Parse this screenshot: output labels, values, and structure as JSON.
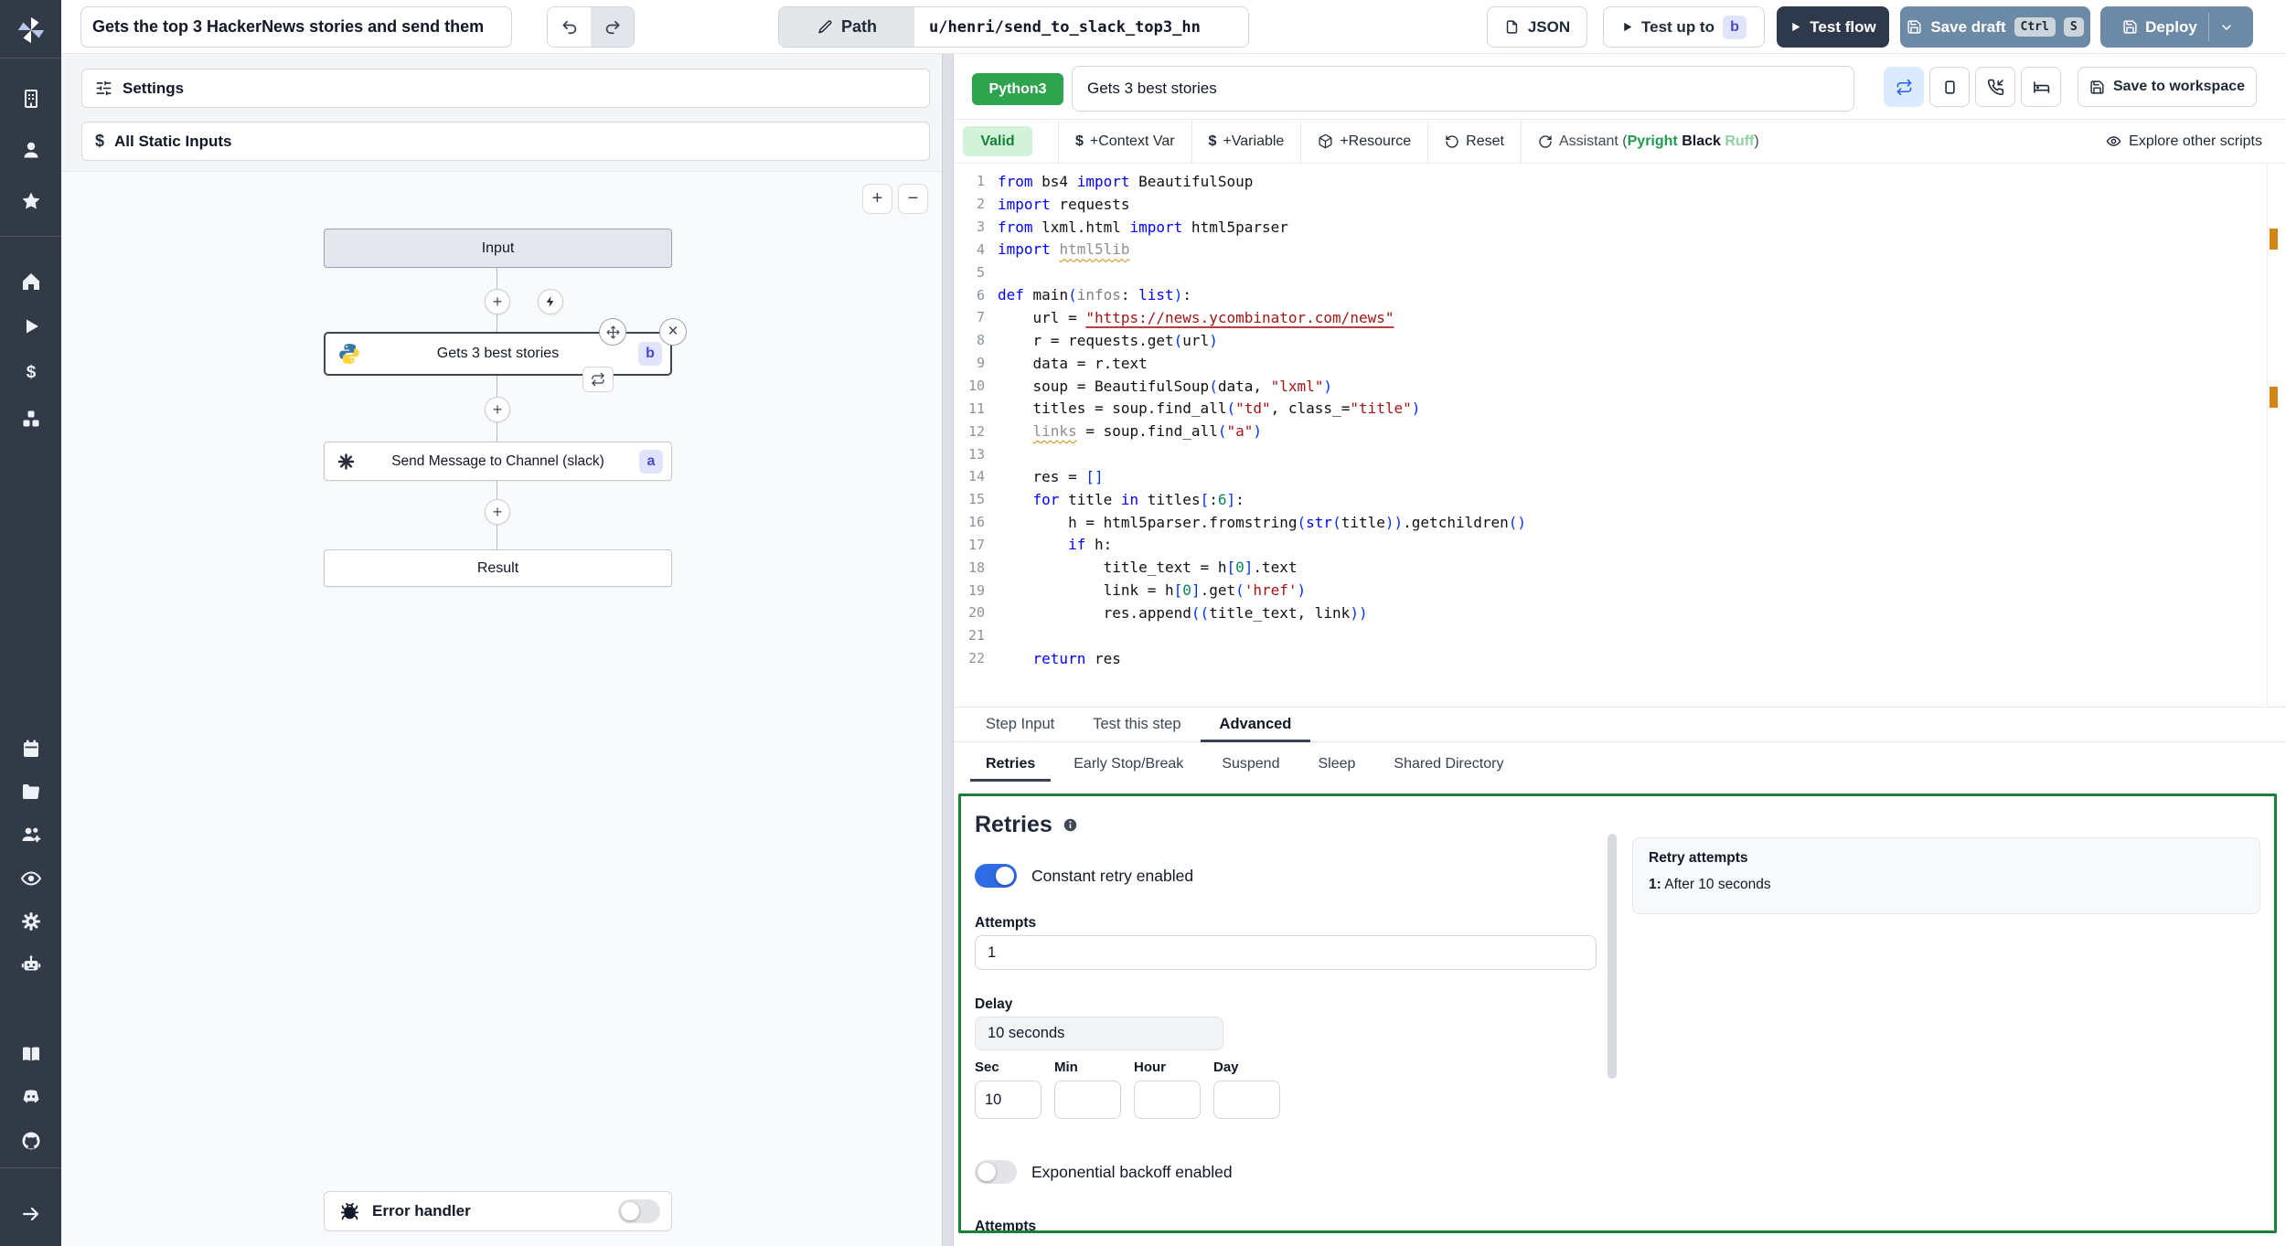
{
  "topbar": {
    "flow_title": "Gets the top 3 HackerNews stories and send them",
    "path_label": "Path",
    "path_value": "u/henri/send_to_slack_top3_hn",
    "json_button": "JSON",
    "test_up_to": "Test up to",
    "step_badge_b": "b",
    "test_flow": "Test flow",
    "save_draft": "Save draft",
    "kbd": [
      "Ctrl",
      "S"
    ],
    "deploy": "Deploy"
  },
  "sidebar": {
    "icons": [
      "windmill-logo",
      "building",
      "user",
      "star",
      "home",
      "play",
      "dollar",
      "boxes",
      "calendar",
      "folder",
      "user-group",
      "eye",
      "gear",
      "robot",
      "book",
      "discord",
      "github",
      "arrow-right"
    ]
  },
  "flow": {
    "settings_label": "Settings",
    "static_inputs_label": "All Static Inputs",
    "input_node": "Input",
    "step_b_label": "Gets 3 best stories",
    "step_b_badge": "b",
    "step_a_label": "Send Message to Channel (slack)",
    "step_a_badge": "a",
    "result_node": "Result",
    "error_handler_label": "Error handler"
  },
  "canvas": {
    "zoom_in": "+",
    "zoom_out": "−"
  },
  "editor": {
    "language": "Python3",
    "name": "Gets 3 best stories",
    "save_to_workspace": "Save to workspace",
    "toolbar": {
      "valid": "Valid",
      "context_var": "+Context Var",
      "variable": "+Variable",
      "resource": "+Resource",
      "reset": "Reset",
      "assistant_parts": [
        {
          "c": "d",
          "t": "Assistant "
        },
        {
          "c": "d",
          "t": "("
        },
        {
          "c": "g",
          "t": "Pyright"
        },
        {
          "c": "d",
          "t": " "
        },
        {
          "c": "b",
          "t": "Black"
        },
        {
          "c": "d",
          "t": " "
        },
        {
          "c": "l",
          "t": "Ruff"
        },
        {
          "c": "d",
          "t": ")"
        }
      ],
      "explore": "Explore other scripts"
    },
    "code_lines": [
      [
        [
          "k",
          "from"
        ],
        [
          "d",
          " bs4 "
        ],
        [
          "k",
          "import"
        ],
        [
          "d",
          " BeautifulSoup"
        ]
      ],
      [
        [
          "k",
          "import"
        ],
        [
          "d",
          " requests"
        ]
      ],
      [
        [
          "k",
          "from"
        ],
        [
          "d",
          " lxml.html "
        ],
        [
          "k",
          "import"
        ],
        [
          "d",
          " html5parser"
        ]
      ],
      [
        [
          "k",
          "import"
        ],
        [
          "d",
          " "
        ],
        [
          "u",
          "html5lib"
        ]
      ],
      [],
      [
        [
          "k",
          "def"
        ],
        [
          "d",
          " main"
        ],
        [
          "p",
          "("
        ],
        [
          "g",
          "infos"
        ],
        [
          "d",
          ": "
        ],
        [
          "k",
          "list"
        ],
        [
          "p",
          ")"
        ],
        [
          "d",
          ":"
        ]
      ],
      [
        [
          "d",
          "    url = "
        ],
        [
          "sl",
          "\"https://news.ycombinator.com/news\""
        ]
      ],
      [
        [
          "d",
          "    r = requests.get"
        ],
        [
          "p",
          "("
        ],
        [
          "d",
          "url"
        ],
        [
          "p",
          ")"
        ]
      ],
      [
        [
          "d",
          "    data = r.text"
        ]
      ],
      [
        [
          "d",
          "    soup = BeautifulSoup"
        ],
        [
          "p",
          "("
        ],
        [
          "d",
          "data, "
        ],
        [
          "s",
          "\"lxml\""
        ],
        [
          "p",
          ")"
        ]
      ],
      [
        [
          "d",
          "    titles = soup.find_all"
        ],
        [
          "p",
          "("
        ],
        [
          "s",
          "\"td\""
        ],
        [
          "d",
          ", class_="
        ],
        [
          "s",
          "\"title\""
        ],
        [
          "p",
          ")"
        ]
      ],
      [
        [
          "d",
          "    "
        ],
        [
          "u",
          "links"
        ],
        [
          "d",
          " = soup.find_all"
        ],
        [
          "p",
          "("
        ],
        [
          "s",
          "\"a\""
        ],
        [
          "p",
          ")"
        ]
      ],
      [],
      [
        [
          "d",
          "    res = "
        ],
        [
          "p",
          "[]"
        ]
      ],
      [
        [
          "d",
          "    "
        ],
        [
          "k",
          "for"
        ],
        [
          "d",
          " title "
        ],
        [
          "k",
          "in"
        ],
        [
          "d",
          " titles"
        ],
        [
          "p",
          "["
        ],
        [
          "d",
          ":"
        ],
        [
          "n",
          "6"
        ],
        [
          "p",
          "]"
        ],
        [
          "d",
          ":"
        ]
      ],
      [
        [
          "d",
          "        h = html5parser.fromstring"
        ],
        [
          "p",
          "("
        ],
        [
          "k",
          "str"
        ],
        [
          "p",
          "("
        ],
        [
          "d",
          "title"
        ],
        [
          "p",
          ")"
        ],
        [
          "p",
          ")"
        ],
        [
          "d",
          ".getchildren"
        ],
        [
          "p",
          "()"
        ]
      ],
      [
        [
          "d",
          "        "
        ],
        [
          "k",
          "if"
        ],
        [
          "d",
          " h:"
        ]
      ],
      [
        [
          "d",
          "            title_text = h"
        ],
        [
          "p",
          "["
        ],
        [
          "n",
          "0"
        ],
        [
          "p",
          "]"
        ],
        [
          "d",
          ".text"
        ]
      ],
      [
        [
          "d",
          "            link = h"
        ],
        [
          "p",
          "["
        ],
        [
          "n",
          "0"
        ],
        [
          "p",
          "]"
        ],
        [
          "d",
          ".get"
        ],
        [
          "p",
          "("
        ],
        [
          "s",
          "'href'"
        ],
        [
          "p",
          ")"
        ]
      ],
      [
        [
          "d",
          "            res.append"
        ],
        [
          "p",
          "(("
        ],
        [
          "d",
          "title_text, link"
        ],
        [
          "p",
          "))"
        ]
      ],
      [],
      [
        [
          "d",
          "    "
        ],
        [
          "k",
          "return"
        ],
        [
          "d",
          " res"
        ]
      ]
    ]
  },
  "tabs": {
    "main": [
      {
        "label": "Step Input",
        "active": false
      },
      {
        "label": "Test this step",
        "active": false
      },
      {
        "label": "Advanced",
        "active": true
      }
    ],
    "sub": [
      {
        "label": "Retries",
        "active": true
      },
      {
        "label": "Early Stop/Break",
        "active": false
      },
      {
        "label": "Suspend",
        "active": false
      },
      {
        "label": "Sleep",
        "active": false
      },
      {
        "label": "Shared Directory",
        "active": false
      }
    ]
  },
  "retries": {
    "title": "Retries",
    "constant_label": "Constant retry enabled",
    "attempts_label": "Attempts",
    "attempts_value": "1",
    "delay_label": "Delay",
    "delay_value": "10 seconds",
    "units": [
      {
        "label": "Sec",
        "value": "10"
      },
      {
        "label": "Min",
        "value": ""
      },
      {
        "label": "Hour",
        "value": ""
      },
      {
        "label": "Day",
        "value": ""
      }
    ],
    "exponential_label": "Exponential backoff enabled",
    "attempts2_label": "Attempts",
    "summary_title": "Retry attempts",
    "summary_item_prefix": "1:",
    "summary_item_text": " After 10 seconds"
  },
  "colors": {
    "sidebar_bg": "#323947",
    "steel_blue_button": "#6c8aa5",
    "dark_button": "#2e3a4c",
    "language_badge_green": "#2ea44f",
    "valid_badge_green": "#d3f2da",
    "panel_border_green": "#1a7f37",
    "toggle_on_blue": "#2e6be5",
    "ruler_marker_orange": "#d18616",
    "step_badge_bg": "#e0e4fc",
    "step_badge_text": "#4649c8"
  }
}
